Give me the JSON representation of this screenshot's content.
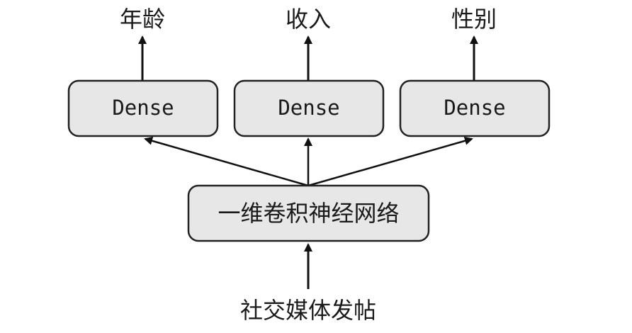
{
  "diagram": {
    "outputs": [
      "年龄",
      "收入",
      "性别"
    ],
    "dense_labels": [
      "Dense",
      "Dense",
      "Dense"
    ],
    "encoder_label": "一维卷积神经网络",
    "input_label": "社交媒体发帖",
    "colors": {
      "box_fill": "#e7e7e7",
      "box_stroke": "#222222",
      "arrow": "#111111",
      "text": "#1a1a1a"
    }
  }
}
